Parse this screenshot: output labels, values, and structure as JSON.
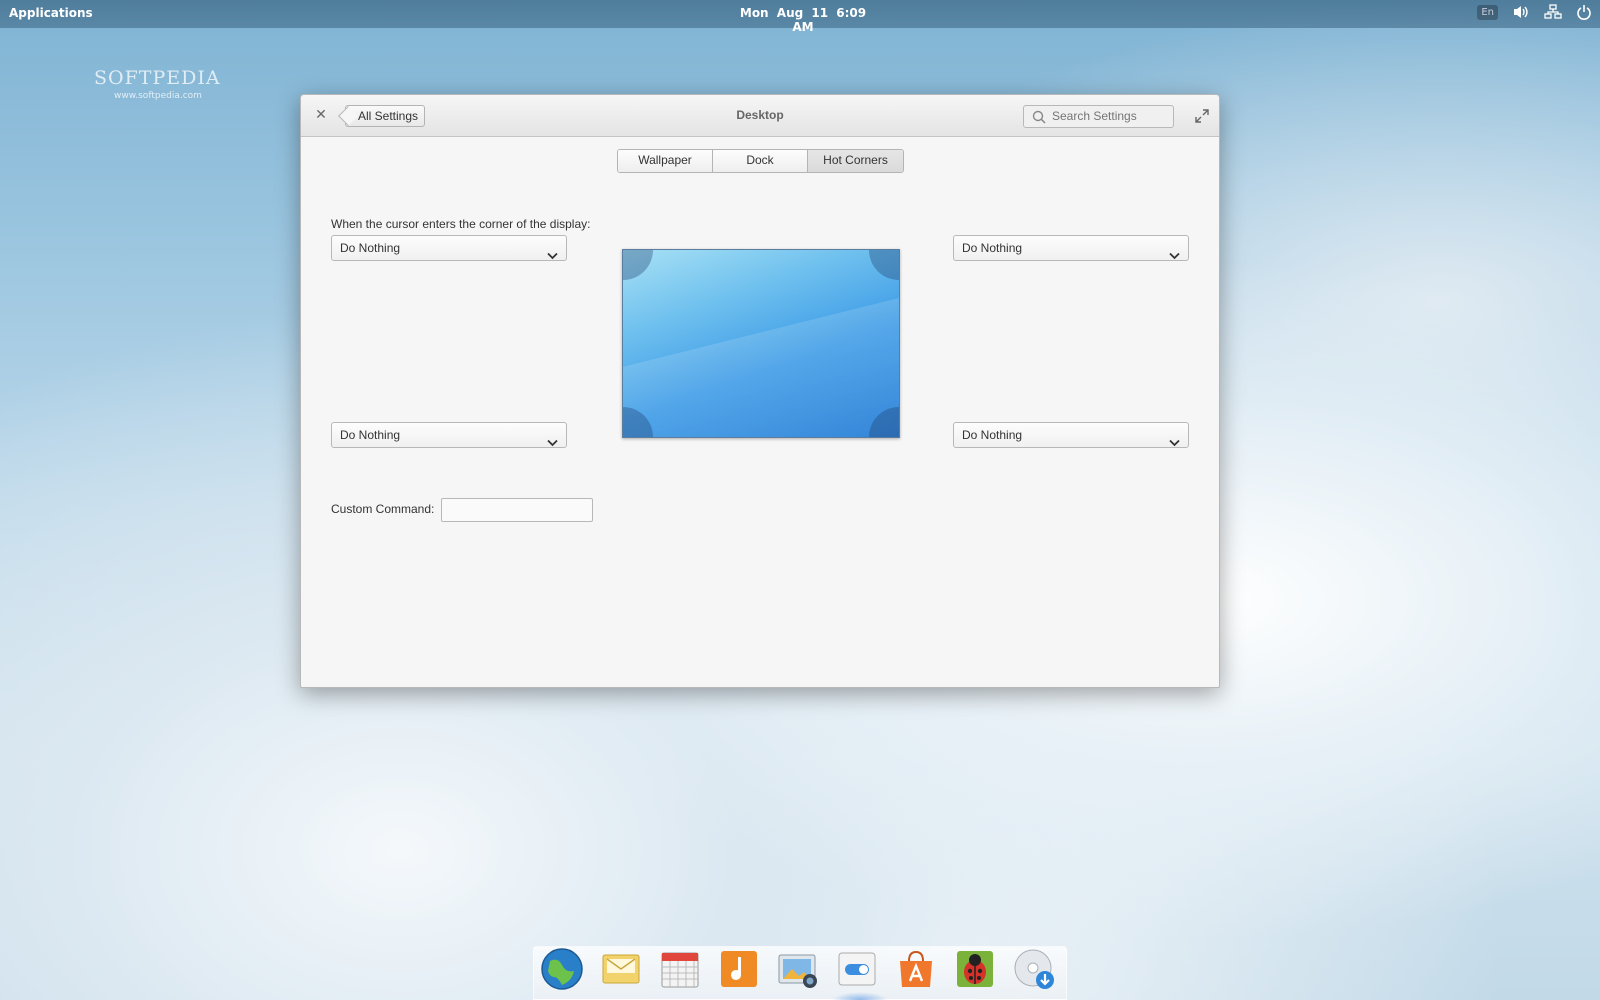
{
  "panel": {
    "applications_label": "Applications",
    "date": "Mon Aug 11",
    "time": "6:09 AM",
    "keyboard_layout": "En"
  },
  "watermark": {
    "brand": "SOFTPEDIA",
    "url": "www.softpedia.com"
  },
  "window": {
    "title": "Desktop",
    "back_label": "All Settings",
    "search_placeholder": "Search Settings",
    "tabs": [
      {
        "label": "Wallpaper",
        "active": false
      },
      {
        "label": "Dock",
        "active": false
      },
      {
        "label": "Hot Corners",
        "active": true
      }
    ],
    "description": "When the cursor enters the corner of the display:",
    "corners": {
      "top_left": "Do Nothing",
      "top_right": "Do Nothing",
      "bottom_left": "Do Nothing",
      "bottom_right": "Do Nothing"
    },
    "custom_command_label": "Custom Command:",
    "custom_command_value": ""
  },
  "dock": {
    "items": [
      "web-browser-icon",
      "mail-icon",
      "calendar-icon",
      "music-icon",
      "photos-icon",
      "settings-icon",
      "app-center-icon",
      "bug-icon",
      "disk-installer-icon"
    ],
    "active_item": "settings-icon"
  }
}
